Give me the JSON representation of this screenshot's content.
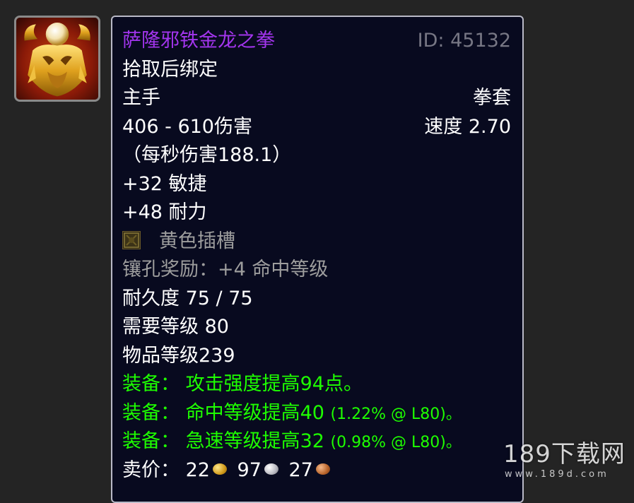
{
  "item": {
    "name": "萨隆邪铁金龙之拳",
    "id_label": "ID: 45132",
    "binding": "拾取后绑定",
    "slot": "主手",
    "type": "拳套",
    "damage": "406 - 610伤害",
    "speed": "速度 2.70",
    "dps": "（每秒伤害188.1）",
    "stat_agility": "+32 敏捷",
    "stat_stamina": "+48 耐力",
    "socket_label": "黄色插槽",
    "socket_bonus": "镶孔奖励：+4 命中等级",
    "durability": "耐久度 75 / 75",
    "required_level": "需要等级 80",
    "item_level": "物品等级239",
    "equip_effects": [
      {
        "main": "装备：  攻击强度提高94点。",
        "extra": ""
      },
      {
        "main": "装备：  命中等级提高40 ",
        "extra": "(1.22% @ L80)。"
      },
      {
        "main": "装备：  急速等级提高32 ",
        "extra": "(0.98% @ L80)。"
      }
    ],
    "sell_label": "卖价：",
    "sell_gold": "22",
    "sell_silver": "97",
    "sell_copper": "27"
  },
  "watermark": {
    "main": "189下载网",
    "sub": "www.189d.com"
  },
  "colors": {
    "epic": "#a335ee",
    "uncommon_green": "#1eff00",
    "poor_gray": "#9d9d9d",
    "tooltip_bg": "#080a1f"
  },
  "icons": {
    "item_icon": "golden-dragon-fist-icon",
    "socket": "yellow-socket-icon",
    "gold": "gold-coin-icon",
    "silver": "silver-coin-icon",
    "copper": "copper-coin-icon"
  }
}
